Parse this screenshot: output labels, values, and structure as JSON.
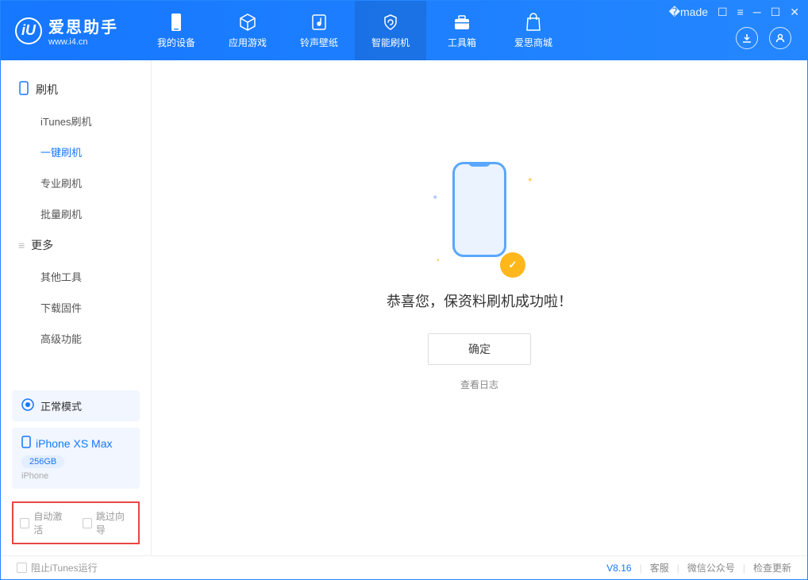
{
  "app": {
    "title": "爱思助手",
    "subtitle": "www.i4.cn"
  },
  "nav": {
    "items": [
      {
        "label": "我的设备"
      },
      {
        "label": "应用游戏"
      },
      {
        "label": "铃声壁纸"
      },
      {
        "label": "智能刷机"
      },
      {
        "label": "工具箱"
      },
      {
        "label": "爱思商城"
      }
    ]
  },
  "sidebar": {
    "section1": {
      "title": "刷机",
      "children": [
        "iTunes刷机",
        "一键刷机",
        "专业刷机",
        "批量刷机"
      ]
    },
    "section2": {
      "title": "更多",
      "children": [
        "其他工具",
        "下载固件",
        "高级功能"
      ]
    },
    "status_label": "正常模式",
    "device": {
      "name": "iPhone XS Max",
      "capacity": "256GB",
      "type": "iPhone"
    },
    "checkbox1": "自动激活",
    "checkbox2": "跳过向导"
  },
  "main": {
    "success_text": "恭喜您，保资料刷机成功啦！",
    "ok_button": "确定",
    "view_log": "查看日志"
  },
  "footer": {
    "block_itunes": "阻止iTunes运行",
    "version": "V8.16",
    "links": [
      "客服",
      "微信公众号",
      "检查更新"
    ]
  }
}
